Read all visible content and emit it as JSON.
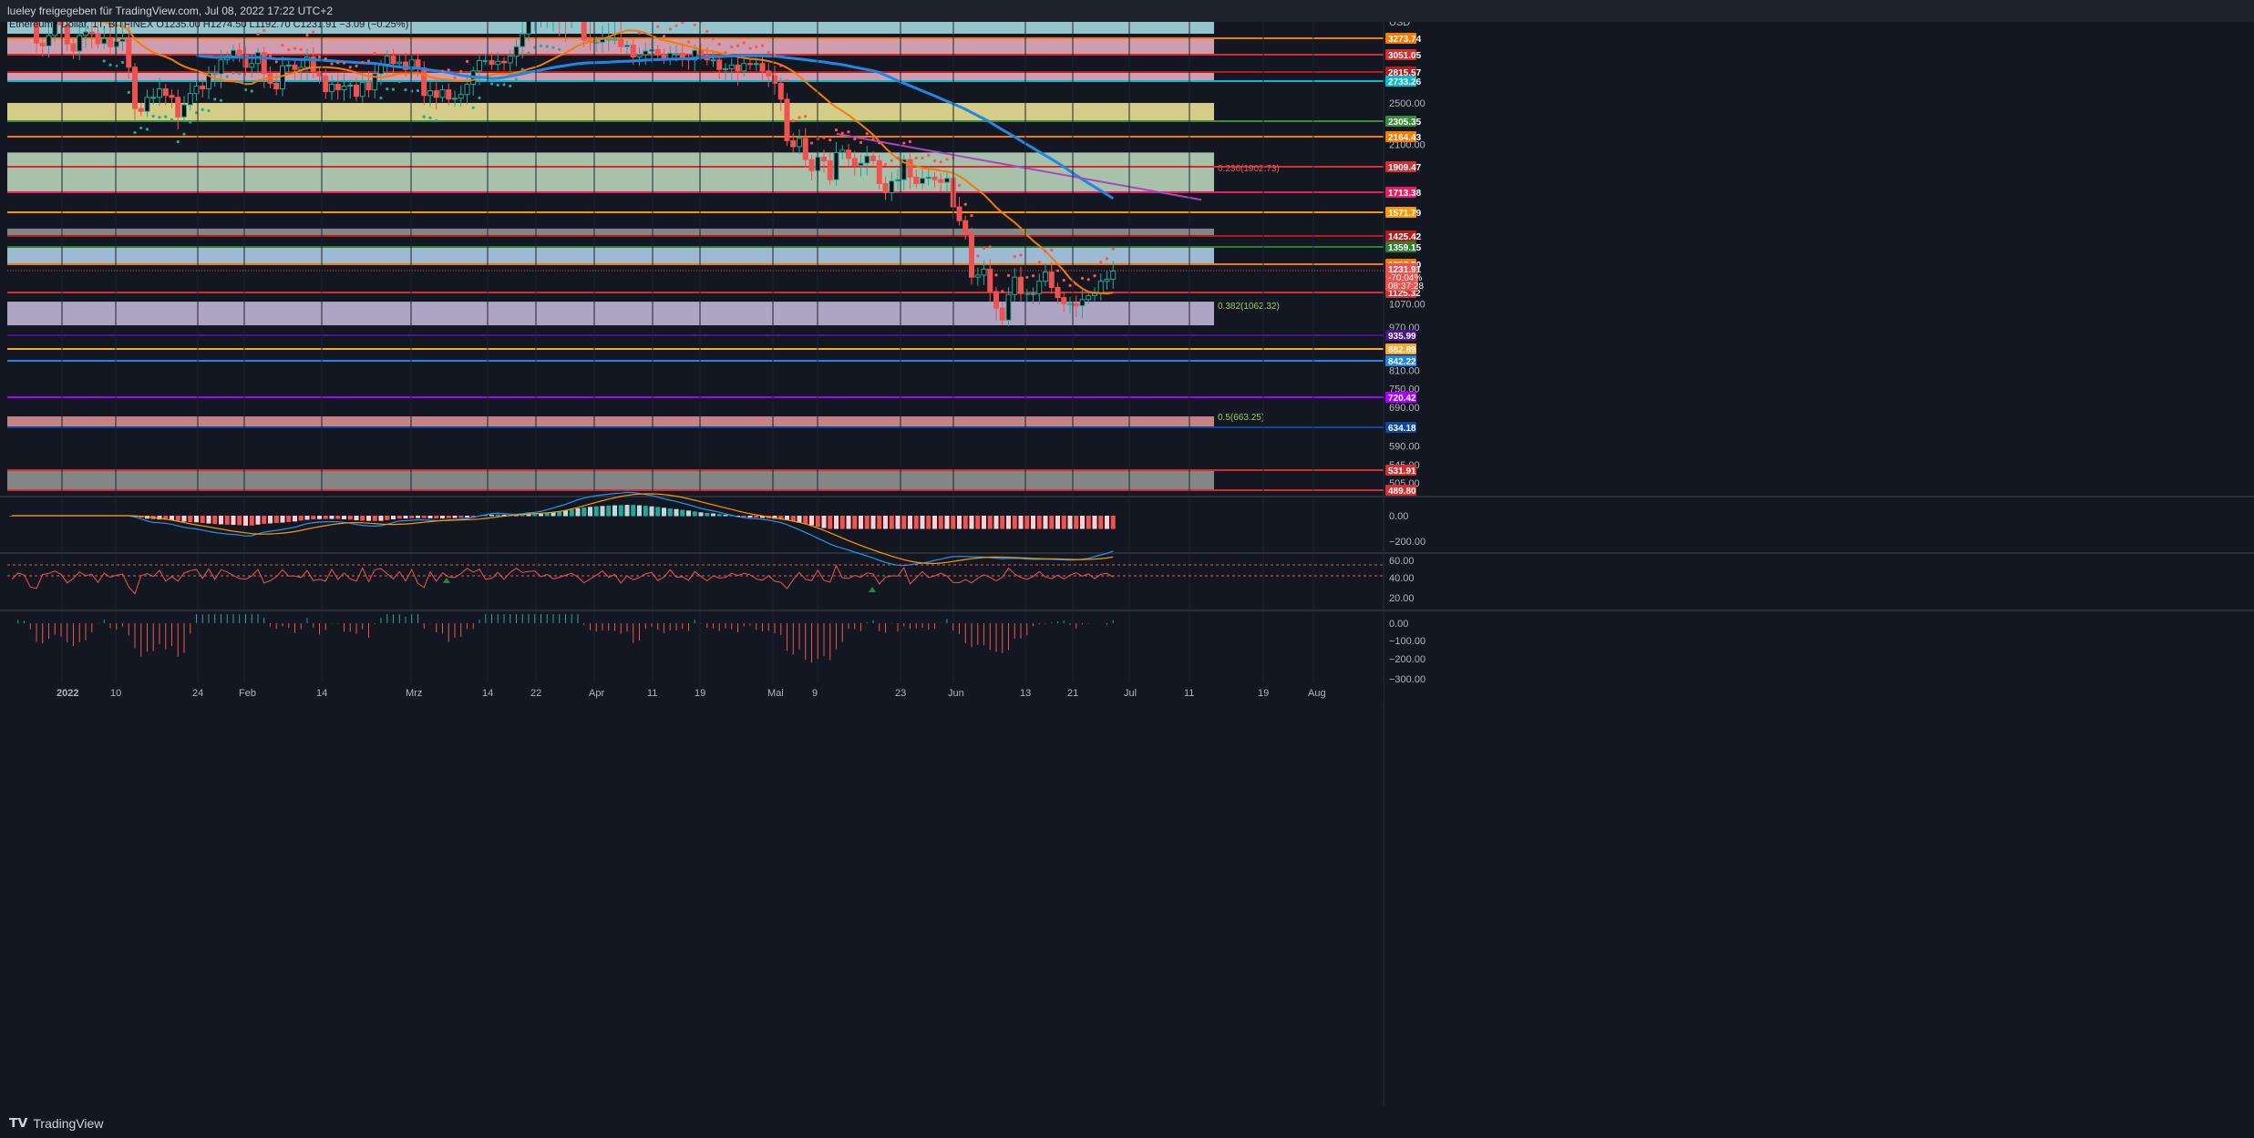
{
  "header": {
    "title": "lueley freigegeben für TradingView.com, Jul 08, 2022 17:22 UTC+2",
    "symbol_line": "Ethereum / Dollar, 1T, BITFINEX  O1235.00  H1274.50  L1192.70  C1231.91  −3.09 (−0.25%)"
  },
  "footer": {
    "brand": "TradingView"
  },
  "colors": {
    "background": "#131722",
    "up": "#26a69a",
    "down": "#ef5350",
    "ema_orange": "#f57c00",
    "sma_blue": "#1e88e5",
    "psar": "#ff5252"
  },
  "chart_data": [
    {
      "type": "candlestick",
      "symbol": "Ethereum / Dollar, 1T, BITFINEX",
      "y_axis_unit": "USD",
      "ylim": [
        480,
        3400
      ],
      "x_ticks": [
        "2022",
        "10",
        "24",
        "Feb",
        "14",
        "Mrz",
        "14",
        "22",
        "Apr",
        "11",
        "19",
        "Mai",
        "9",
        "23",
        "Jun",
        "13",
        "21",
        "Jul",
        "11",
        "19",
        "Aug"
      ],
      "y_ticks": [
        3273.74,
        3051.05,
        2815.57,
        2733.26,
        2500.0,
        2305.35,
        2164.43,
        2100.0,
        1909.47,
        1713.38,
        1571.79,
        1425.42,
        1359.15,
        1267.2,
        1125.32,
        1070.0,
        970.0,
        935.99,
        882.89,
        842.22,
        810.0,
        750.0,
        720.42,
        690.0,
        634.18,
        590.0,
        545.0,
        531.91,
        505.0,
        489.8
      ],
      "horizontal_levels": [
        {
          "price": 3273.74,
          "label": "3273.74",
          "color": "#f57c00"
        },
        {
          "price": 3051.05,
          "label": "3051.05",
          "color": "#d32f2f"
        },
        {
          "price": 2815.57,
          "label": "2815.57",
          "color": "#b71c1c"
        },
        {
          "price": 2733.26,
          "label": "2733.26",
          "color": "#00bcd4"
        },
        {
          "price": 2305.35,
          "label": "2305.35",
          "color": "#388e3c"
        },
        {
          "price": 2164.43,
          "label": "2164.43",
          "color": "#f57c00"
        },
        {
          "price": 1909.47,
          "label": "1909.47",
          "color": "#d32f2f"
        },
        {
          "price": 1713.38,
          "label": "1713.38",
          "color": "#e91e63"
        },
        {
          "price": 1571.79,
          "label": "1571.79",
          "color": "#ff9800"
        },
        {
          "price": 1425.42,
          "label": "1425.42",
          "color": "#b71c1c"
        },
        {
          "price": 1359.15,
          "label": "1359.15",
          "color": "#2e7d32"
        },
        {
          "price": 1267.2,
          "label": "1267.20",
          "color": "#f57c00"
        },
        {
          "price": 1125.32,
          "label": "1125.32",
          "color": "#d32f2f"
        },
        {
          "price": 935.99,
          "label": "935.99",
          "color": "#4a148c"
        },
        {
          "price": 882.89,
          "label": "882.89",
          "color": "#ffa726"
        },
        {
          "price": 842.22,
          "label": "842.22",
          "color": "#1e88e5"
        },
        {
          "price": 720.42,
          "label": "720.42",
          "color": "#aa00ff"
        },
        {
          "price": 634.18,
          "label": "634.18",
          "color": "#0d47a1"
        },
        {
          "price": 531.91,
          "label": "531.91",
          "color": "#d32f2f"
        },
        {
          "price": 489.8,
          "label": "489.80",
          "color": "#d32f2f"
        }
      ],
      "zones": [
        {
          "from": 3300,
          "to": 3400,
          "color": "#b2ebf2"
        },
        {
          "from": 3051.05,
          "to": 3273.74,
          "color": "#f8bbd0"
        },
        {
          "from": 2733.26,
          "to": 2815.57,
          "color": "#f8bbd0"
        },
        {
          "from": 2305.35,
          "to": 2500,
          "color": "#fff59d"
        },
        {
          "from": 1713.38,
          "to": 2030,
          "color": "#c8e6c9"
        },
        {
          "from": 1425.42,
          "to": 1471,
          "color": "#9e9e9e"
        },
        {
          "from": 1267.2,
          "to": 1359.15,
          "color": "#bbdefb"
        },
        {
          "from": 978,
          "to": 1080,
          "color": "#d1c4e9"
        },
        {
          "from": 634.18,
          "to": 663.25,
          "color": "#ef9a9a"
        },
        {
          "from": 489.8,
          "to": 531.91,
          "color": "#9e9e9e"
        }
      ],
      "fib_labels": [
        {
          "text": "0.236(1902.73)",
          "price": 1902.73,
          "color": "#ef5350"
        },
        {
          "text": "0.382(1062.32)",
          "price": 1062.32,
          "color": "#9ccc65"
        },
        {
          "text": "0.5(663.25)",
          "price": 663.25,
          "color": "#9ccc65"
        }
      ],
      "last_price": {
        "value": "1231.91",
        "change": "-70.04%",
        "countdown": "08:37:28",
        "price": 1231.91
      },
      "candles_close": [
        3700,
        3790,
        3760,
        3540,
        3210,
        3170,
        3290,
        3400,
        3350,
        3200,
        3100,
        3290,
        3310,
        3300,
        3200,
        3270,
        3160,
        3230,
        3260,
        2880,
        2440,
        2410,
        2560,
        2560,
        2650,
        2580,
        2560,
        2350,
        2480,
        2600,
        2680,
        2650,
        2800,
        2800,
        2980,
        3030,
        3110,
        3040,
        2880,
        2930,
        3080,
        2800,
        2710,
        2650,
        2900,
        2910,
        2850,
        2880,
        3020,
        2820,
        2780,
        2620,
        2700,
        2640,
        2680,
        2690,
        2570,
        2720,
        2640,
        2800,
        2920,
        3030,
        2930,
        2950,
        2850,
        2980,
        2870,
        2580,
        2630,
        2560,
        2640,
        2540,
        2550,
        2590,
        2700,
        2830,
        2970,
        2970,
        2920,
        2960,
        2940,
        3030,
        3160,
        3300,
        3400,
        3440,
        3450,
        3450,
        3460,
        3440,
        3400,
        3540,
        3510,
        3250,
        3220,
        3220,
        3260,
        3260,
        3260,
        3160,
        3180,
        3020,
        3050,
        3100,
        3120,
        3050,
        3000,
        3070,
        3070,
        3010,
        2980,
        3110,
        3040,
        2980,
        2980,
        2850,
        2860,
        2910,
        2830,
        2930,
        2920,
        2930,
        2830,
        2780,
        2710,
        2540,
        2130,
        2080,
        2150,
        1970,
        1880,
        1990,
        1960,
        1810,
        2030,
        2050,
        1980,
        1920,
        1940,
        2000,
        1960,
        1780,
        1710,
        1800,
        1810,
        1970,
        1830,
        1780,
        1820,
        1830,
        1810,
        1790,
        1820,
        1610,
        1520,
        1440,
        1200,
        1210,
        1240,
        1130,
        1050,
        1000,
        1115,
        1200,
        1120,
        1120,
        1120,
        1180,
        1225,
        1150,
        1100,
        1070,
        1070,
        1060,
        1090,
        1110,
        1120,
        1180,
        1190,
        1230
      ]
    },
    {
      "type": "line",
      "indicator": "MACD",
      "y_ticks": [
        "0.00",
        "−200.00"
      ],
      "ylim": [
        -320,
        220
      ]
    },
    {
      "type": "line",
      "indicator": "RSI",
      "y_ticks": [
        "60.00",
        "40.00",
        "20.00"
      ],
      "ylim": [
        5,
        75
      ]
    },
    {
      "type": "bar",
      "indicator": "Momentum",
      "y_ticks": [
        "0.00",
        "−100.00",
        "−200.00",
        "−300.00"
      ],
      "ylim": [
        -320,
        40
      ]
    }
  ]
}
